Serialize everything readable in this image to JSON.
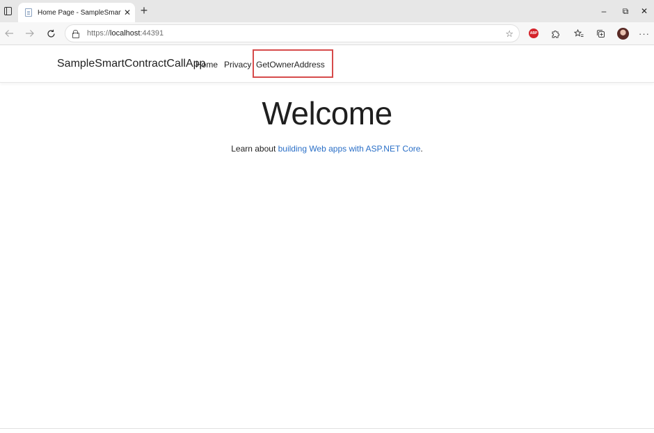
{
  "browser": {
    "tab_title": "Home Page - SampleSmartContr",
    "close_glyph": "✕",
    "new_tab_glyph": "+",
    "url_scheme": "https://",
    "url_host": "localhost",
    "url_port": ":44391",
    "abp_label": "ABP",
    "window_controls": {
      "minimize": "–",
      "restore": "⧉",
      "close": "✕"
    }
  },
  "site": {
    "brand": "SampleSmartContractCallApp",
    "nav": [
      "Home",
      "Privacy",
      "GetOwnerAddress"
    ],
    "highlighted_nav_index": 2
  },
  "main": {
    "heading": "Welcome",
    "lead_prefix": "Learn about ",
    "lead_link": "building Web apps with ASP.NET Core",
    "lead_suffix": "."
  },
  "colors": {
    "link": "#2a6fc7",
    "highlight_border": "#d64a4a",
    "abp_badge": "#d4232b"
  }
}
